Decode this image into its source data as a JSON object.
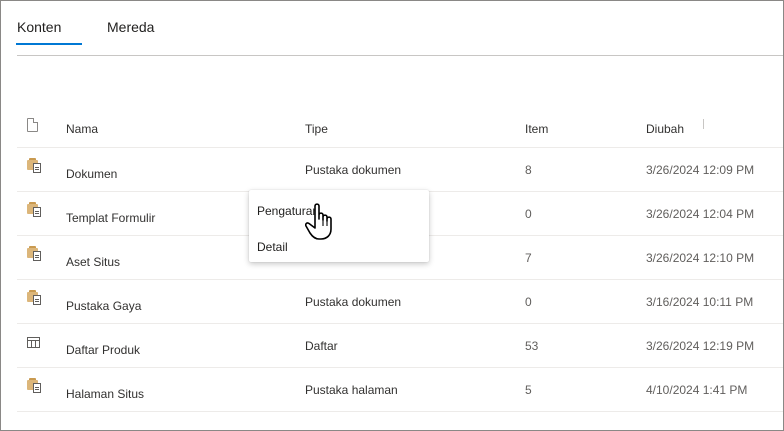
{
  "tabs": [
    {
      "label": "Konten",
      "active": true
    },
    {
      "label": "Mereda",
      "active": false
    }
  ],
  "table": {
    "headers": {
      "icon": "file-icon",
      "name": "Nama",
      "type": "Tipe",
      "items": "Item",
      "modified": "Diubah"
    },
    "rows": [
      {
        "icon": "library-icon",
        "name": "Dokumen",
        "type": "Pustaka dokumen",
        "items": "8",
        "modified": "3/26/2024 12:09 PM"
      },
      {
        "icon": "library-icon",
        "name": "Templat Formulir",
        "type": "",
        "items": "0",
        "modified": "3/26/2024 12:04 PM"
      },
      {
        "icon": "library-icon",
        "name": "Aset Situs",
        "type": "",
        "items": "7",
        "modified": "3/26/2024 12:10 PM"
      },
      {
        "icon": "library-icon",
        "name": "Pustaka Gaya",
        "type": "Pustaka dokumen",
        "items": "0",
        "modified": "3/16/2024 10:11 PM"
      },
      {
        "icon": "list-icon",
        "name": "Daftar Produk",
        "type": "Daftar",
        "items": "53",
        "modified": "3/26/2024 12:19 PM"
      },
      {
        "icon": "library-icon",
        "name": "Halaman Situs",
        "type": "Pustaka halaman",
        "items": "5",
        "modified": "4/10/2024 1:41 PM"
      }
    ]
  },
  "context_menu": {
    "items": [
      {
        "label": "Pengaturan"
      },
      {
        "label": "Detail"
      }
    ]
  },
  "colors": {
    "accent": "#0078d4",
    "folder": "#dcb67a"
  }
}
